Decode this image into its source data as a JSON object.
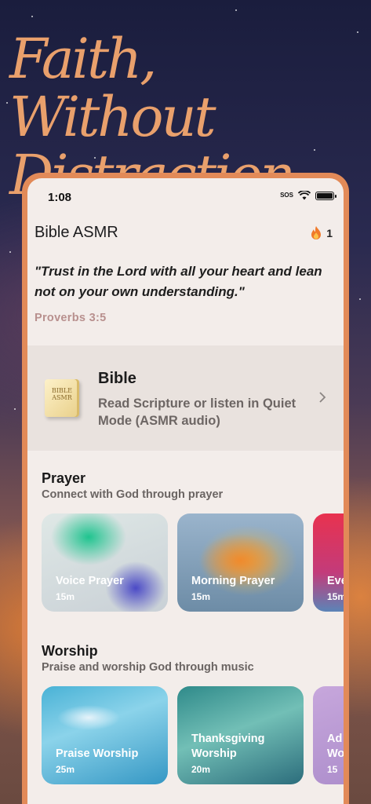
{
  "headline": [
    "Faith, Without",
    "Distraction."
  ],
  "status_bar": {
    "time": "1:08",
    "sos": "SOS"
  },
  "header": {
    "app_title": "Bible ASMR",
    "streak_count": "1"
  },
  "verse": {
    "text": "\"Trust in the Lord with all your heart and lean not on your own understanding.\"",
    "reference": "Proverbs 3:5"
  },
  "bible_card": {
    "book_label": "BIBLE ASMR",
    "title": "Bible",
    "description": "Read Scripture or listen in Quiet Mode (ASMR audio)"
  },
  "prayer": {
    "title": "Prayer",
    "subtitle": "Connect with God through prayer",
    "cards": [
      {
        "title": "Voice Prayer",
        "duration": "15m"
      },
      {
        "title": "Morning Prayer",
        "duration": "15m"
      },
      {
        "title": "Eve",
        "duration": "15m"
      }
    ]
  },
  "worship": {
    "title": "Worship",
    "subtitle": "Praise and worship God through music",
    "cards": [
      {
        "title": "Praise Worship",
        "duration": "25m"
      },
      {
        "title": "Thanksgiving Worship",
        "duration": "20m"
      },
      {
        "title": "Ad Wo",
        "duration": "15"
      }
    ]
  },
  "colors": {
    "accent": "#e28a58",
    "headline": "#e9a06c",
    "reference": "#b8908e"
  },
  "icons": [
    "wifi-icon",
    "battery-icon",
    "flame-icon",
    "bible-book-icon",
    "chevron-right-icon"
  ]
}
